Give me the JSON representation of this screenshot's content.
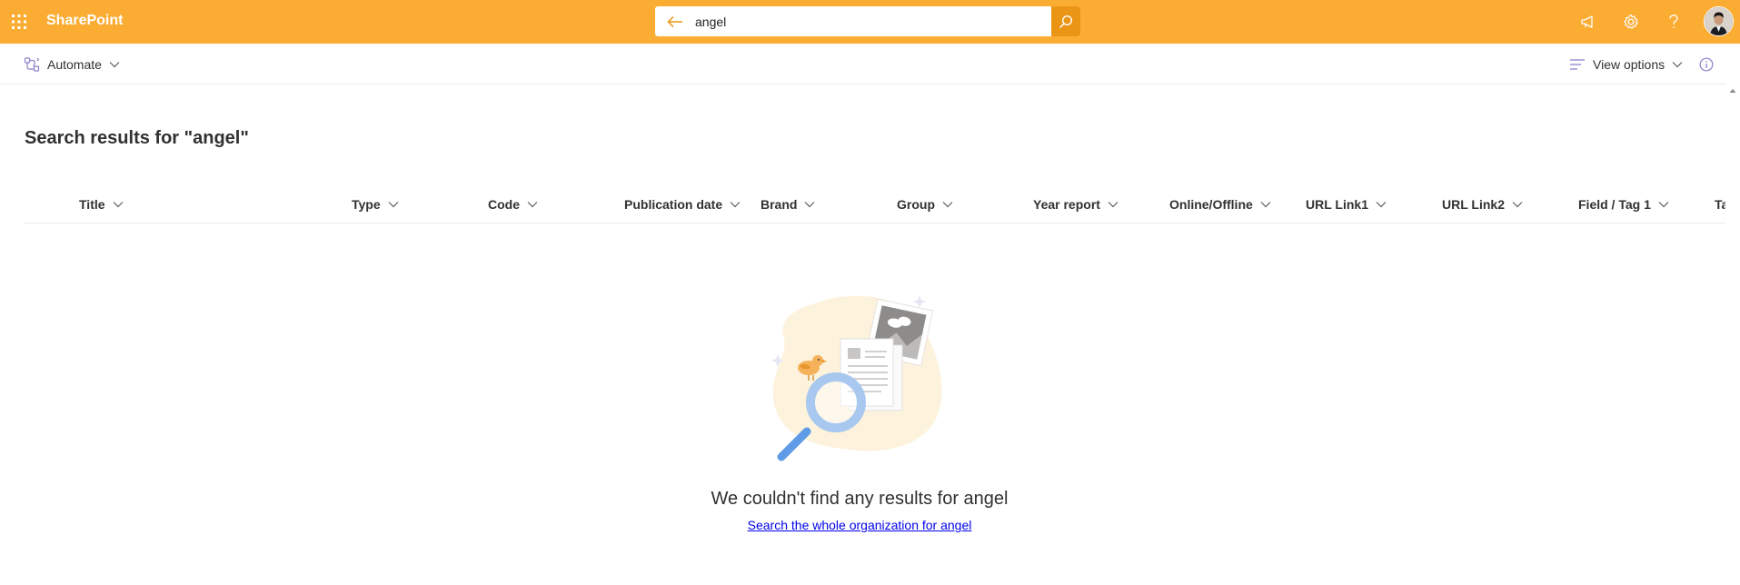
{
  "suite": {
    "app_name": "SharePoint",
    "search_value": "angel",
    "accent_color": "#fbac32"
  },
  "command_bar": {
    "automate_label": "Automate",
    "view_options_label": "View options"
  },
  "page": {
    "results_title": "Search results for \"angel\""
  },
  "columns": [
    {
      "label": "Title"
    },
    {
      "label": "Type"
    },
    {
      "label": "Code"
    },
    {
      "label": "Publication date"
    },
    {
      "label": "Brand"
    },
    {
      "label": "Group"
    },
    {
      "label": "Year report"
    },
    {
      "label": "Online/Offline"
    },
    {
      "label": "URL Link1"
    },
    {
      "label": "URL Link2"
    },
    {
      "label": "Field / Tag 1"
    },
    {
      "label": "Ta"
    }
  ],
  "empty_state": {
    "message": "We couldn't find any results for angel",
    "link_text": "Search the whole organization for angel"
  }
}
